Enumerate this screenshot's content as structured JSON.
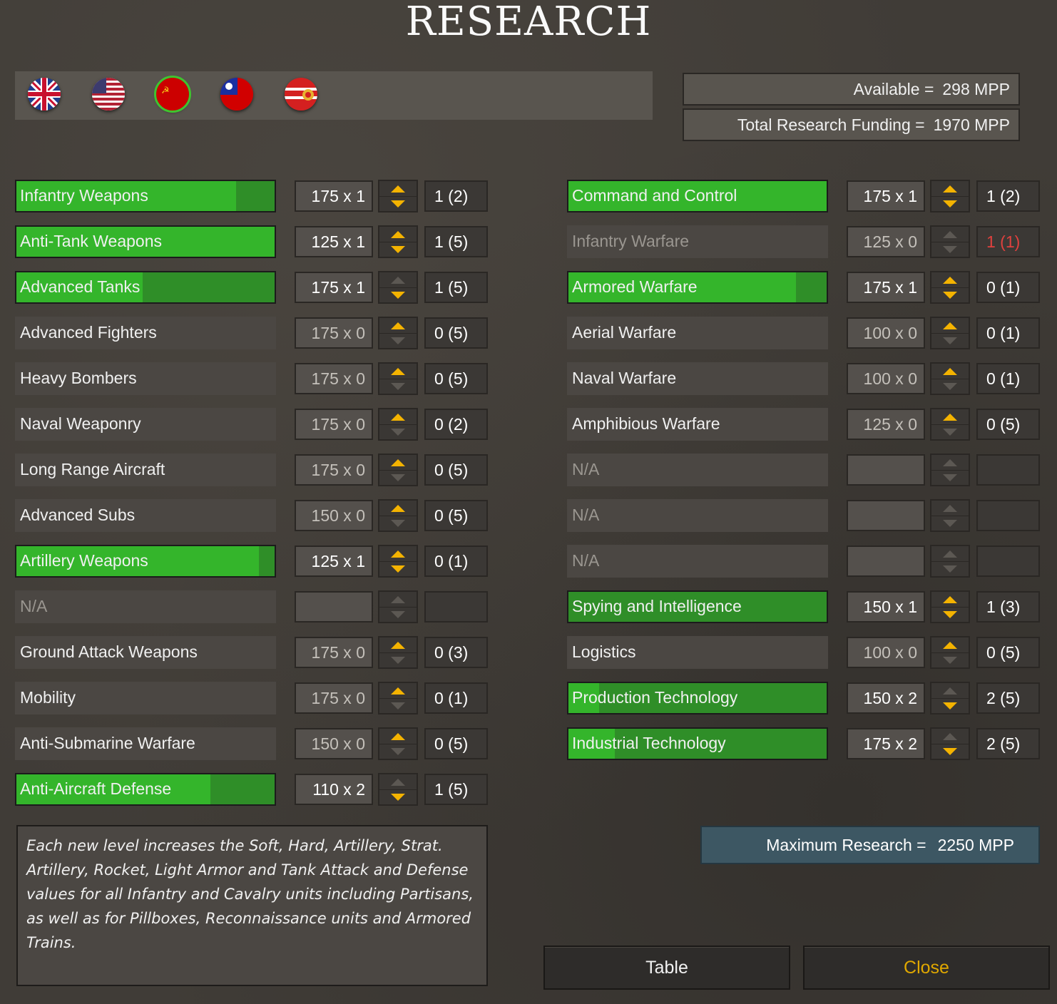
{
  "title": "RESEARCH",
  "nations": [
    {
      "icon": "uk-flag-icon",
      "selected": false
    },
    {
      "icon": "usa-flag-icon",
      "selected": false
    },
    {
      "icon": "ussr-flag-icon",
      "selected": true
    },
    {
      "icon": "china-flag-icon",
      "selected": false
    },
    {
      "icon": "china-communist-flag-icon",
      "selected": false
    }
  ],
  "available": {
    "label": "Available =",
    "value": "298 MPP"
  },
  "total_funding": {
    "label": "Total Research Funding =",
    "value": "1970 MPP"
  },
  "left_column": [
    {
      "name": "Infantry Weapons",
      "cost": "175 x 1",
      "level": "1 (2)",
      "active": true,
      "progress": 0.85,
      "up": true,
      "down": true
    },
    {
      "name": "Anti-Tank Weapons",
      "cost": "125 x 1",
      "level": "1 (5)",
      "active": true,
      "progress": 1.0,
      "up": true,
      "down": true
    },
    {
      "name": "Advanced Tanks",
      "cost": "175 x 1",
      "level": "1 (5)",
      "active": true,
      "progress": 0.49,
      "up": false,
      "down": true
    },
    {
      "name": "Advanced Fighters",
      "cost": "175 x 0",
      "level": "0 (5)",
      "active": false,
      "progress": 0,
      "up": true,
      "down": false
    },
    {
      "name": "Heavy Bombers",
      "cost": "175 x 0",
      "level": "0 (5)",
      "active": false,
      "progress": 0,
      "up": true,
      "down": false
    },
    {
      "name": "Naval Weaponry",
      "cost": "175 x 0",
      "level": "0 (2)",
      "active": false,
      "progress": 0,
      "up": true,
      "down": false
    },
    {
      "name": "Long Range Aircraft",
      "cost": "175 x 0",
      "level": "0 (5)",
      "active": false,
      "progress": 0,
      "up": true,
      "down": false
    },
    {
      "name": "Advanced Subs",
      "cost": "150 x 0",
      "level": "0 (5)",
      "active": false,
      "progress": 0,
      "up": true,
      "down": false
    },
    {
      "name": "Artillery Weapons",
      "cost": "125 x 1",
      "level": "0 (1)",
      "active": true,
      "progress": 0.94,
      "up": true,
      "down": true
    },
    {
      "name": "N/A",
      "cost": "",
      "level": "",
      "active": false,
      "disabled": true,
      "progress": 0,
      "up": false,
      "down": false
    },
    {
      "name": "Ground Attack Weapons",
      "cost": "175 x 0",
      "level": "0 (3)",
      "active": false,
      "progress": 0,
      "up": true,
      "down": false
    },
    {
      "name": "Mobility",
      "cost": "175 x 0",
      "level": "0 (1)",
      "active": false,
      "progress": 0,
      "up": true,
      "down": false
    },
    {
      "name": "Anti-Submarine Warfare",
      "cost": "150 x 0",
      "level": "0 (5)",
      "active": false,
      "progress": 0,
      "up": true,
      "down": false
    },
    {
      "name": "Anti-Aircraft Defense",
      "cost": "110 x 2",
      "level": "1 (5)",
      "active": true,
      "progress": 0.75,
      "up": false,
      "down": true
    }
  ],
  "right_column": [
    {
      "name": "Command and Control",
      "cost": "175 x 1",
      "level": "1 (2)",
      "active": true,
      "progress": 1.0,
      "up": true,
      "down": true
    },
    {
      "name": "Infantry Warfare",
      "cost": "125 x 0",
      "level": "1 (1)",
      "active": false,
      "disabled": true,
      "level_red": true,
      "progress": 0,
      "up": false,
      "down": false
    },
    {
      "name": "Armored Warfare",
      "cost": "175 x 1",
      "level": "0 (1)",
      "active": true,
      "progress": 0.88,
      "up": true,
      "down": true
    },
    {
      "name": "Aerial Warfare",
      "cost": "100 x 0",
      "level": "0 (1)",
      "active": false,
      "progress": 0,
      "up": true,
      "down": false
    },
    {
      "name": "Naval Warfare",
      "cost": "100 x 0",
      "level": "0 (1)",
      "active": false,
      "progress": 0,
      "up": true,
      "down": false
    },
    {
      "name": "Amphibious Warfare",
      "cost": "125 x 0",
      "level": "0 (5)",
      "active": false,
      "progress": 0,
      "up": true,
      "down": false
    },
    {
      "name": "N/A",
      "cost": "",
      "level": "",
      "active": false,
      "disabled": true,
      "progress": 0,
      "up": false,
      "down": false
    },
    {
      "name": "N/A",
      "cost": "",
      "level": "",
      "active": false,
      "disabled": true,
      "progress": 0,
      "up": false,
      "down": false
    },
    {
      "name": "N/A",
      "cost": "",
      "level": "",
      "active": false,
      "disabled": true,
      "progress": 0,
      "up": false,
      "down": false
    },
    {
      "name": "Spying and Intelligence",
      "cost": "150 x 1",
      "level": "1 (3)",
      "active": true,
      "progress": 0.0,
      "up": true,
      "down": true
    },
    {
      "name": "Logistics",
      "cost": "100 x 0",
      "level": "0 (5)",
      "active": false,
      "progress": 0,
      "up": true,
      "down": false
    },
    {
      "name": "Production Technology",
      "cost": "150 x 2",
      "level": "2 (5)",
      "active": true,
      "progress": 0.12,
      "up": false,
      "down": true
    },
    {
      "name": "Industrial Technology",
      "cost": "175 x 2",
      "level": "2 (5)",
      "active": true,
      "progress": 0.18,
      "up": false,
      "down": true
    }
  ],
  "description": "Each new level increases the Soft, Hard, Artillery, Strat. Artillery, Rocket, Light Armor and Tank Attack and Defense values for all Infantry and Cavalry units including Partisans, as well as for Pillboxes, Reconnaissance units and Armored Trains.",
  "maximum_research": {
    "label": "Maximum Research =",
    "value": "2250 MPP"
  },
  "buttons": {
    "table": "Table",
    "close": "Close"
  },
  "colors": {
    "active_fill": "#34b52b",
    "active_bg": "#2f8e28",
    "arrow_on": "#f4b300",
    "close_text": "#e0a800",
    "max_bg": "#3d5763"
  }
}
